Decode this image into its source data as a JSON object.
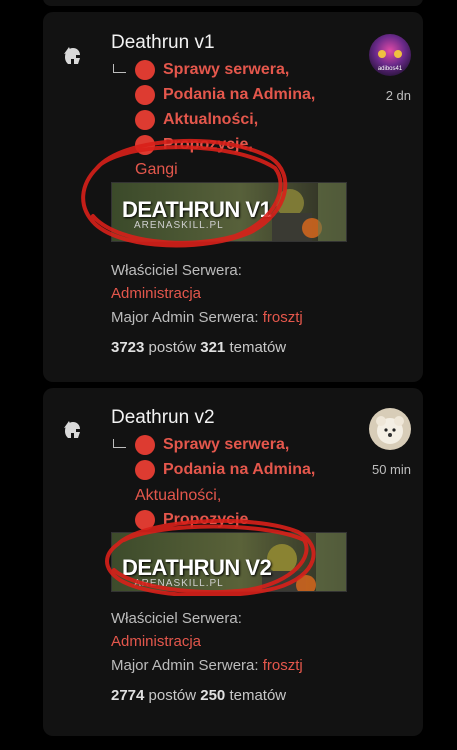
{
  "forums": [
    {
      "title": "Deathrun v1",
      "subforums": [
        {
          "label": "Sprawy serwera,",
          "unread": true
        },
        {
          "label": "Podania na Admina,",
          "unread": true
        },
        {
          "label": "Aktualności,",
          "unread": true
        },
        {
          "label": "Propozycje,",
          "unread": true
        },
        {
          "label": "Gangi",
          "unread": false
        }
      ],
      "banner": {
        "title": "DEATHRUN V1",
        "sub": "ARENASKILL.PL"
      },
      "owner_label": "Właściciel Serwera:",
      "owner_value": "Administracja",
      "major_label": "Major Admin Serwera:",
      "major_value": "frosztj",
      "posts_count": "3723",
      "posts_word": "postów",
      "topics_count": "321",
      "topics_word": "tematów",
      "last_post_time": "2 dn",
      "avatar_text": "adibos41"
    },
    {
      "title": "Deathrun v2",
      "subforums": [
        {
          "label": "Sprawy serwera,",
          "unread": true
        },
        {
          "label": "Podania na Admina,",
          "unread": true
        },
        {
          "label": "Aktualności,",
          "unread": false
        },
        {
          "label": "Propozycje",
          "unread": true
        }
      ],
      "banner": {
        "title": "DEATHRUN V2",
        "sub": "ARENASKILL.PL"
      },
      "owner_label": "Właściciel Serwera:",
      "owner_value": "Administracja",
      "major_label": "Major Admin Serwera:",
      "major_value": "frosztj",
      "posts_count": "2774",
      "posts_word": "postów",
      "topics_count": "250",
      "topics_word": "tematów",
      "last_post_time": "50 min"
    }
  ],
  "colors": {
    "accent": "#e4574c",
    "unread_dot": "#dd3b31",
    "card_bg": "#121212",
    "annotation_red": "#d8201a"
  }
}
